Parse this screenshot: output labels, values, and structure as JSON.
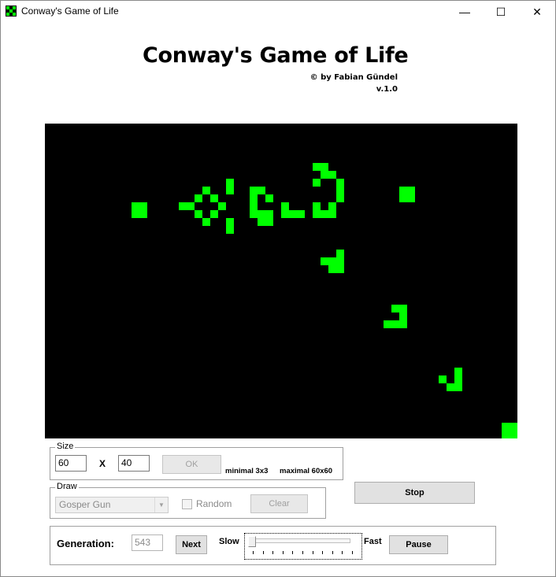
{
  "window": {
    "title": "Conway's Game of Life",
    "minimize": "—",
    "maximize": "☐",
    "close": "✕"
  },
  "header": {
    "title": "Conway's Game of Life",
    "byline": "© by Fabian Gündel",
    "version": "v.1.0"
  },
  "board": {
    "columns": 60,
    "rows": 40,
    "alive_color": "#00ff00",
    "dead_color": "#000000",
    "live_cells": [
      [
        11,
        10
      ],
      [
        12,
        10
      ],
      [
        11,
        11
      ],
      [
        12,
        11
      ],
      [
        17,
        10
      ],
      [
        18,
        10
      ],
      [
        19,
        9
      ],
      [
        20,
        8
      ],
      [
        19,
        11
      ],
      [
        20,
        12
      ],
      [
        21,
        9
      ],
      [
        21,
        11
      ],
      [
        22,
        10
      ],
      [
        23,
        7
      ],
      [
        23,
        8
      ],
      [
        23,
        12
      ],
      [
        23,
        13
      ],
      [
        26,
        8
      ],
      [
        27,
        8
      ],
      [
        26,
        9
      ],
      [
        26,
        10
      ],
      [
        26,
        11
      ],
      [
        27,
        11
      ],
      [
        28,
        9
      ],
      [
        27,
        12
      ],
      [
        28,
        12
      ],
      [
        28,
        11
      ],
      [
        30,
        10
      ],
      [
        30,
        11
      ],
      [
        31,
        11
      ],
      [
        32,
        11
      ],
      [
        34,
        5
      ],
      [
        35,
        5
      ],
      [
        35,
        6
      ],
      [
        34,
        7
      ],
      [
        36,
        6
      ],
      [
        37,
        7
      ],
      [
        37,
        8
      ],
      [
        37,
        9
      ],
      [
        36,
        10
      ],
      [
        35,
        11
      ],
      [
        34,
        11
      ],
      [
        34,
        10
      ],
      [
        36,
        11
      ],
      [
        45,
        8
      ],
      [
        46,
        8
      ],
      [
        45,
        9
      ],
      [
        46,
        9
      ],
      [
        37,
        16
      ],
      [
        35,
        17
      ],
      [
        36,
        17
      ],
      [
        37,
        17
      ],
      [
        36,
        18
      ],
      [
        37,
        18
      ],
      [
        44,
        23
      ],
      [
        45,
        23
      ],
      [
        45,
        24
      ],
      [
        43,
        25
      ],
      [
        44,
        25
      ],
      [
        45,
        25
      ],
      [
        52,
        31
      ],
      [
        52,
        32
      ],
      [
        50,
        32
      ],
      [
        51,
        33
      ],
      [
        52,
        33
      ],
      [
        58,
        38
      ],
      [
        59,
        38
      ],
      [
        58,
        39
      ],
      [
        59,
        39
      ]
    ]
  },
  "size_group": {
    "label": "Size",
    "width_value": "60",
    "times_label": "X",
    "height_value": "40",
    "ok_label": "OK",
    "minimal_label": "minimal 3x3",
    "maximal_label": "maximal 60x60"
  },
  "draw_group": {
    "label": "Draw",
    "pattern_selected": "Gosper Gun",
    "random_label": "Random",
    "clear_label": "Clear"
  },
  "stop_label": "Stop",
  "generation_group": {
    "label": "Generation:",
    "value": "543",
    "next_label": "Next",
    "slow_label": "Slow",
    "fast_label": "Fast",
    "speed_level": 0,
    "pause_label": "Pause"
  }
}
